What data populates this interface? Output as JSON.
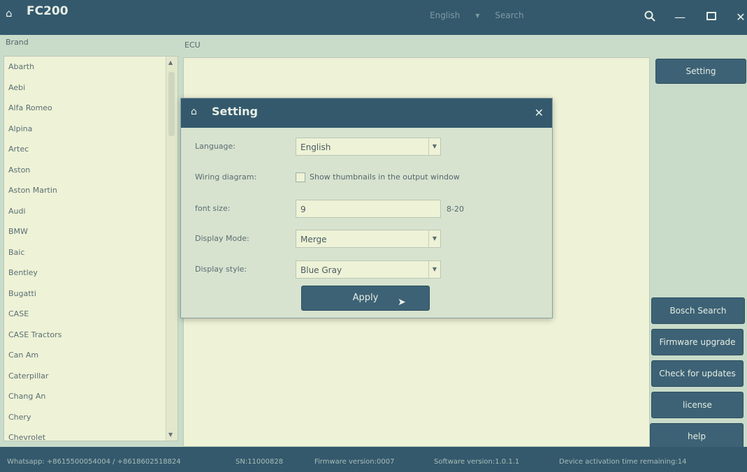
{
  "app": {
    "title": "FC200"
  },
  "search": {
    "label1": "English",
    "placeholder": "Search"
  },
  "labels": {
    "brand": "Brand",
    "ecu": "ECU"
  },
  "brands": [
    "Abarth",
    "Aebi",
    "Alfa Romeo",
    "Alpina",
    "Artec",
    "Aston",
    "Aston Martin",
    "Audi",
    "BMW",
    "Baic",
    "Bentley",
    "Bugatti",
    "CASE",
    "CASE Tractors",
    "Can Am",
    "Caterpillar",
    "Chang An",
    "Chery",
    "Chevrolet"
  ],
  "side_buttons": {
    "setting": "Setting",
    "bosch_search": "Bosch Search",
    "firmware_upgrade": "Firmware upgrade",
    "check_updates": "Check for updates",
    "license": "license",
    "help": "help"
  },
  "dialog": {
    "title": "Setting",
    "language_label": "Language:",
    "language_value": "English",
    "wiring_label": "Wiring diagram:",
    "wiring_checkbox": "Show thumbnails in the output window",
    "font_label": "font size:",
    "font_value": "9",
    "font_range": "8-20",
    "display_mode_label": "Display Mode:",
    "display_mode_value": "Merge",
    "display_style_label": "Display style:",
    "display_style_value": "Blue Gray",
    "apply": "Apply"
  },
  "status": {
    "whatsapp": "Whatsapp: +8615500054004 / +8618602518824",
    "sn": "SN:11000828",
    "firmware": "Firmware version:0007",
    "software": "Software version:1.0.1.1",
    "activation": "Device activation time remaining:14"
  },
  "colors": {
    "primary": "#34596d",
    "background": "#c9dcc9",
    "panel": "#eef2d6"
  }
}
